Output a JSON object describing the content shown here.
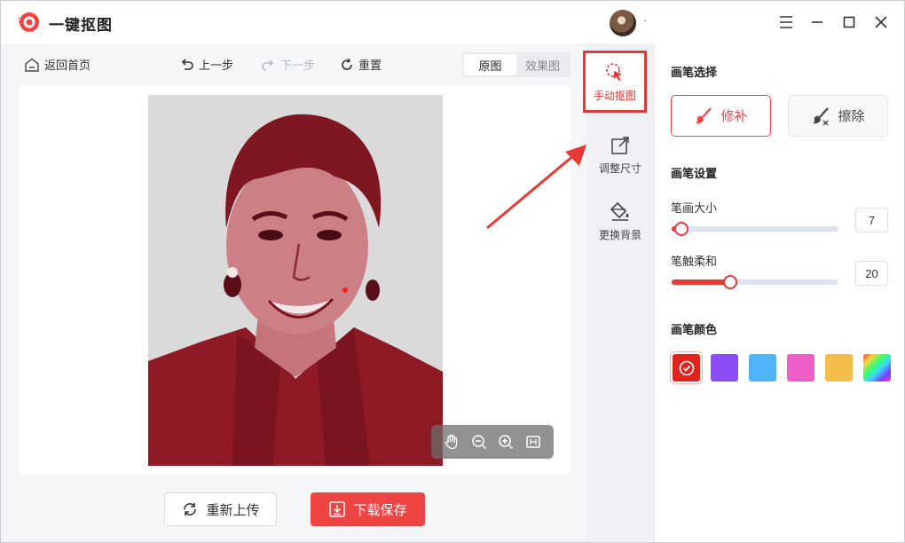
{
  "app": {
    "title": "一键抠图",
    "user_name": "·"
  },
  "toolbar": {
    "home": "返回首页",
    "undo": "上一步",
    "redo": "下一步",
    "reset": "重置",
    "view_tabs": [
      "原图",
      "效果图"
    ],
    "active_view": "原图"
  },
  "actions": {
    "reupload": "重新上传",
    "download": "下载保存"
  },
  "rail": {
    "items": [
      {
        "label": "手动抠图",
        "icon": "manual-cutout-icon",
        "active": true
      },
      {
        "label": "调整尺寸",
        "icon": "resize-icon",
        "active": false
      },
      {
        "label": "更换背景",
        "icon": "paint-bucket-icon",
        "active": false
      }
    ]
  },
  "panel": {
    "brush_select_title": "画笔选择",
    "brush_repair": "修补",
    "brush_erase": "擦除",
    "brush_settings_title": "画笔设置",
    "size_label": "笔画大小",
    "size_value": "7",
    "size_fraction": 0.06,
    "softness_label": "笔触柔和",
    "softness_value": "20",
    "softness_fraction": 0.35,
    "color_title": "画笔颜色",
    "colors": [
      "#e0231c",
      "#8b4cf7",
      "#4fb3f6",
      "#ec5fc9",
      "#f3bd4a",
      "rainbow"
    ],
    "selected_color": 0
  },
  "colors": {
    "accent": "#ef4444",
    "mask": "#b3232f"
  }
}
